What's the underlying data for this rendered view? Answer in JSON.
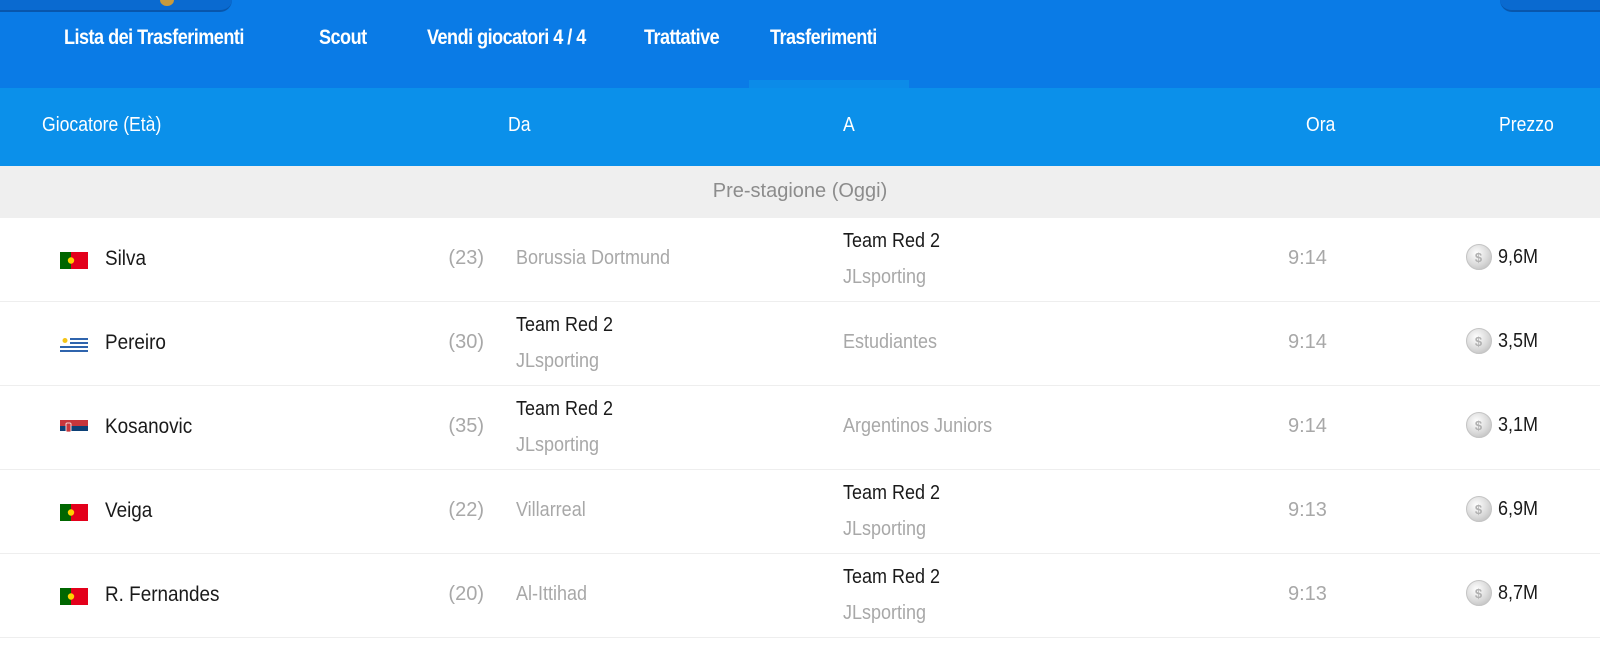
{
  "nav": {
    "tabs": [
      {
        "label": "Lista dei Trasferimenti"
      },
      {
        "label": "Scout"
      },
      {
        "label": "Vendi giocatori 4 / 4"
      },
      {
        "label": "Trattative"
      },
      {
        "label": "Trasferimenti",
        "active": true
      }
    ]
  },
  "table": {
    "headers": {
      "player": "Giocatore (Età)",
      "from": "Da",
      "to": "A",
      "time": "Ora",
      "price": "Prezzo"
    },
    "section_label": "Pre-stagione (Oggi)",
    "rows": [
      {
        "flag": "portugal-flag-icon",
        "name": "Silva",
        "age": "(23)",
        "from": {
          "team": "Borussia Dortmund"
        },
        "to": {
          "team": "Team Red 2",
          "manager": "JLsporting"
        },
        "time": "9:14",
        "price": "9,6M"
      },
      {
        "flag": "uruguay-flag-icon",
        "name": "Pereiro",
        "age": "(30)",
        "from": {
          "team": "Team Red 2",
          "manager": "JLsporting"
        },
        "to": {
          "team": "Estudiantes"
        },
        "time": "9:14",
        "price": "3,5M"
      },
      {
        "flag": "serbia-flag-icon",
        "name": "Kosanovic",
        "age": "(35)",
        "from": {
          "team": "Team Red 2",
          "manager": "JLsporting"
        },
        "to": {
          "team": "Argentinos Juniors"
        },
        "time": "9:14",
        "price": "3,1M"
      },
      {
        "flag": "portugal-flag-icon",
        "name": "Veiga",
        "age": "(22)",
        "from": {
          "team": "Villarreal"
        },
        "to": {
          "team": "Team Red 2",
          "manager": "JLsporting"
        },
        "time": "9:13",
        "price": "6,9M"
      },
      {
        "flag": "portugal-flag-icon",
        "name": "R. Fernandes",
        "age": "(20)",
        "from": {
          "team": "Al-Ittihad"
        },
        "to": {
          "team": "Team Red 2",
          "manager": "JLsporting"
        },
        "time": "9:13",
        "price": "8,7M"
      }
    ]
  },
  "colors": {
    "nav_bg": "#0a7be6",
    "header_bg": "#0b90ea",
    "section_bg": "#efefef",
    "muted_text": "#a8a8a8"
  },
  "icons": {
    "coin": "coin-icon"
  }
}
